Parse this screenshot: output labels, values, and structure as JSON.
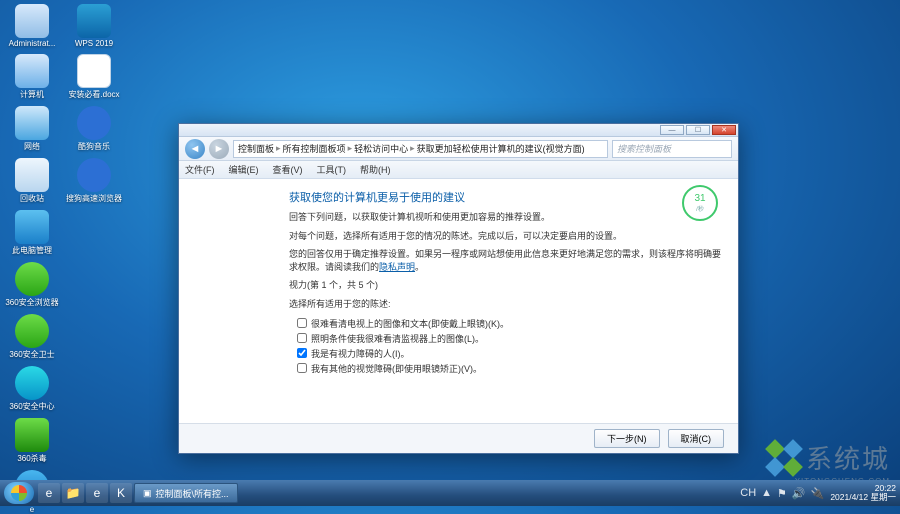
{
  "desktop": {
    "col1": [
      {
        "label": "Administrat...",
        "icon": "admin"
      },
      {
        "label": "计算机",
        "icon": "pc"
      },
      {
        "label": "网络",
        "icon": "net"
      },
      {
        "label": "回收站",
        "icon": "bin"
      },
      {
        "label": "此电脑管理",
        "icon": "app"
      },
      {
        "label": "360安全浏览器",
        "icon": "green"
      },
      {
        "label": "360安全卫士",
        "icon": "green"
      },
      {
        "label": "360安全中心",
        "icon": "cyan"
      },
      {
        "label": "360杀毒",
        "icon": "shield"
      },
      {
        "label": "e",
        "icon": "blue"
      }
    ],
    "col2": [
      {
        "label": "WPS 2019",
        "icon": "wps"
      },
      {
        "label": "安装必看.docx",
        "icon": "doc"
      },
      {
        "label": "酷狗音乐",
        "icon": "ku"
      },
      {
        "label": "搜狗高速浏览器",
        "icon": "so"
      }
    ]
  },
  "window": {
    "title_buttons": {
      "min": "—",
      "max": "☐",
      "close": "✕"
    },
    "nav": {
      "back": "◄",
      "fwd": "►"
    },
    "breadcrumb": [
      "控制面板",
      "所有控制面板项",
      "轻松访问中心",
      "获取更加轻松使用计算机的建议(视觉方面)"
    ],
    "search_placeholder": "搜索控制面板",
    "menus": [
      "文件(F)",
      "编辑(E)",
      "查看(V)",
      "工具(T)",
      "帮助(H)"
    ],
    "meter": {
      "value": "31",
      "unit": "/秒"
    },
    "heading": "获取使您的计算机更易于使用的建议",
    "p1": "回答下列问题，以获取使计算机视听和使用更加容易的推荐设置。",
    "p2": "对每个问题，选择所有适用于您的情况的陈述。完成以后，可以决定要启用的设置。",
    "p3_a": "您的回答仅用于确定推荐设置。如果另一程序或网站想使用此信息来更好地满足您的需求，则该程序将明确要求权限。请阅读我们的",
    "p3_link": "隐私声明",
    "p3_b": "。",
    "step": "视力(第 1 个，共 5 个)",
    "prompt": "选择所有适用于您的陈述:",
    "options": [
      {
        "checked": false,
        "label": "很难看清电视上的图像和文本(即使戴上眼镜)(K)。"
      },
      {
        "checked": false,
        "label": "照明条件使我很难看清监视器上的图像(L)。"
      },
      {
        "checked": true,
        "label": "我是有视力障碍的人(I)。"
      },
      {
        "checked": false,
        "label": "我有其他的视觉障碍(即使用眼镜矫正)(V)。"
      }
    ],
    "buttons": {
      "next": "下一步(N)",
      "cancel": "取消(C)"
    }
  },
  "watermark": {
    "text": "系统城",
    "sub": "XITONGCHENG.COM"
  },
  "taskbar": {
    "pinned": [
      "ie",
      "folder",
      "e",
      "k"
    ],
    "task": "控制面板\\所有控...",
    "tray_icons": [
      "CH",
      "▲",
      "⚑",
      "🔊",
      "🔌"
    ],
    "time": "20:22",
    "date": "2021/4/12 星期一"
  }
}
